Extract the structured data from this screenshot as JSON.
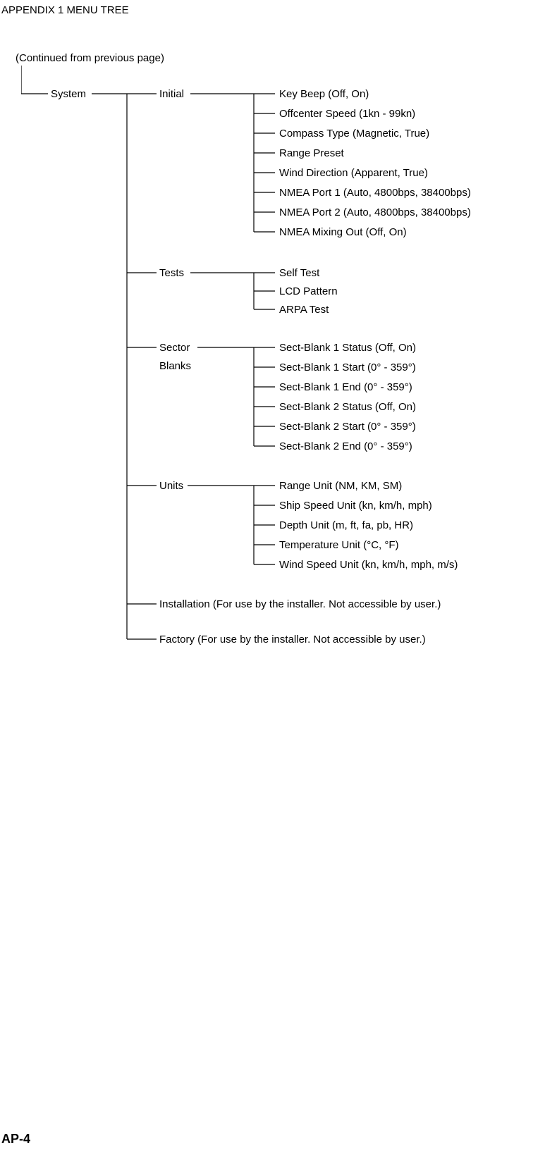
{
  "header": "APPENDIX 1 MENU TREE",
  "continued": "(Continued from previous page)",
  "footer": "AP-4",
  "tree": {
    "system": "System",
    "initial": "Initial",
    "tests": "Tests",
    "sector": "Sector",
    "blanks": "Blanks",
    "units": "Units",
    "installation": "Installation (For use by the installer. Not accessible by user.)",
    "factory": "Factory (For use by the installer. Not accessible by user.)",
    "initial_items": {
      "i0": "Key Beep (Off, On)",
      "i1": "Offcenter Speed (1kn - 99kn)",
      "i2": "Compass Type (Magnetic, True)",
      "i3": "Range Preset",
      "i4": "Wind Direction (Apparent, True)",
      "i5": "NMEA Port 1 (Auto, 4800bps, 38400bps)",
      "i6": "NMEA Port 2 (Auto, 4800bps, 38400bps)",
      "i7": "NMEA Mixing Out (Off, On)"
    },
    "tests_items": {
      "t0": "Self Test",
      "t1": "LCD Pattern",
      "t2": "ARPA Test"
    },
    "sector_items": {
      "s0": "Sect-Blank 1 Status (Off, On)",
      "s1": "Sect-Blank 1 Start (0° - 359°)",
      "s2": "Sect-Blank 1 End (0° - 359°)",
      "s3": "Sect-Blank 2 Status (Off, On)",
      "s4": "Sect-Blank 2 Start (0° - 359°)",
      "s5": "Sect-Blank 2 End (0° - 359°)"
    },
    "units_items": {
      "u0": "Range Unit (NM, KM, SM)",
      "u1": "Ship Speed Unit (kn, km/h, mph)",
      "u2": "Depth Unit (m, ft, fa, pb, HR)",
      "u3": "Temperature Unit (°C, °F)",
      "u4": "Wind Speed Unit (kn, km/h, mph, m/s)"
    }
  }
}
